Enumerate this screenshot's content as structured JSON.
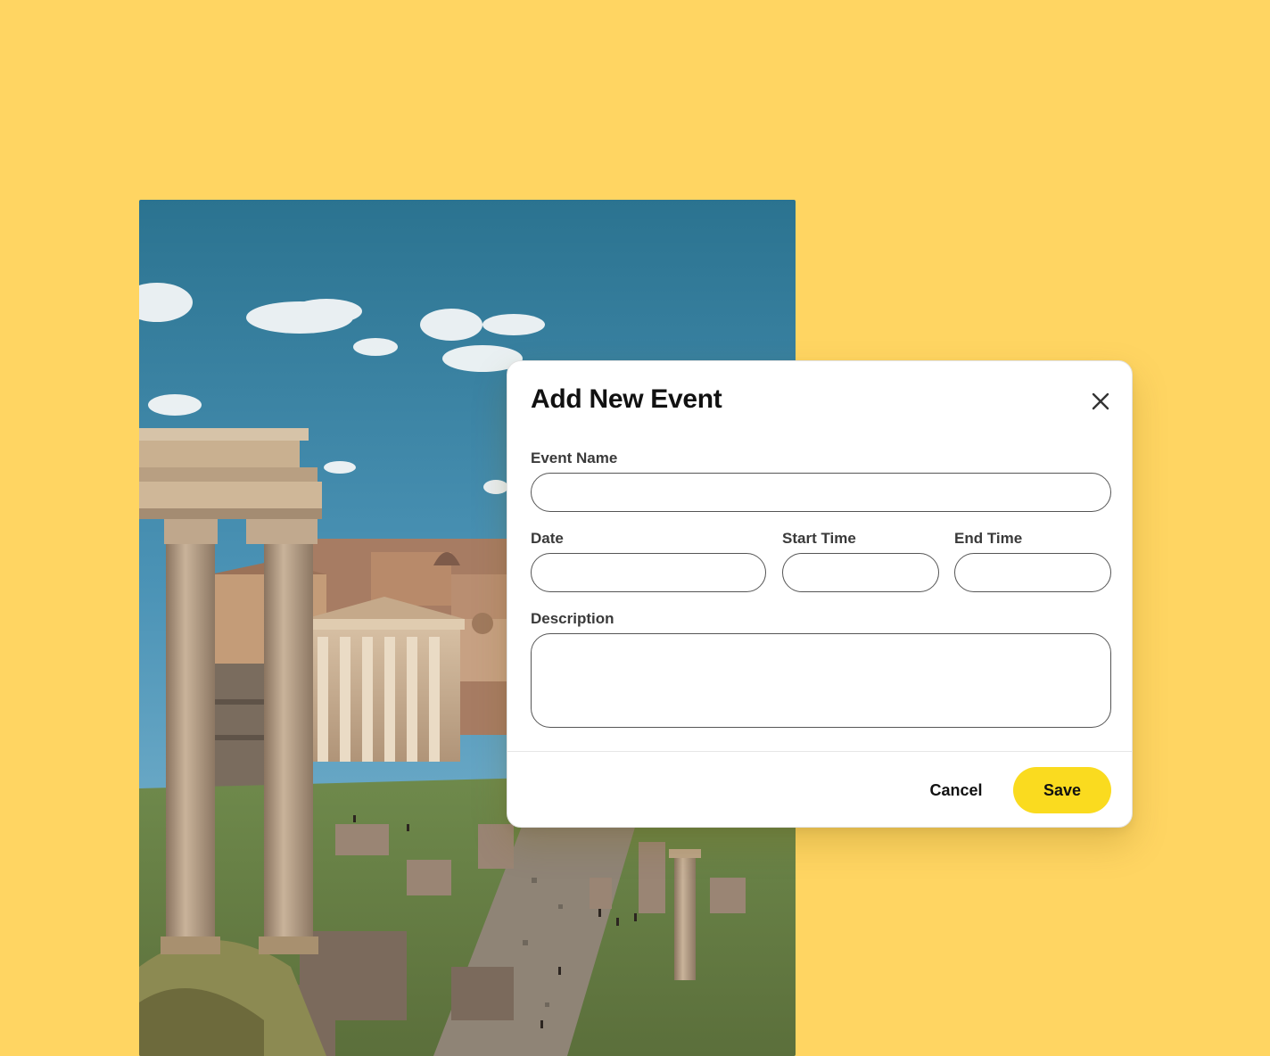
{
  "background_color": "#FFD562",
  "photo": {
    "icon": "roman-forum-photo"
  },
  "dialog": {
    "title": "Add New Event",
    "close_icon": "close-icon",
    "fields": {
      "event_name": {
        "label": "Event Name",
        "value": ""
      },
      "date": {
        "label": "Date",
        "value": ""
      },
      "start_time": {
        "label": "Start Time",
        "value": ""
      },
      "end_time": {
        "label": "End Time",
        "value": ""
      },
      "description": {
        "label": "Description",
        "value": ""
      }
    },
    "footer": {
      "cancel_label": "Cancel",
      "save_label": "Save",
      "save_color": "#FADB1F"
    }
  }
}
